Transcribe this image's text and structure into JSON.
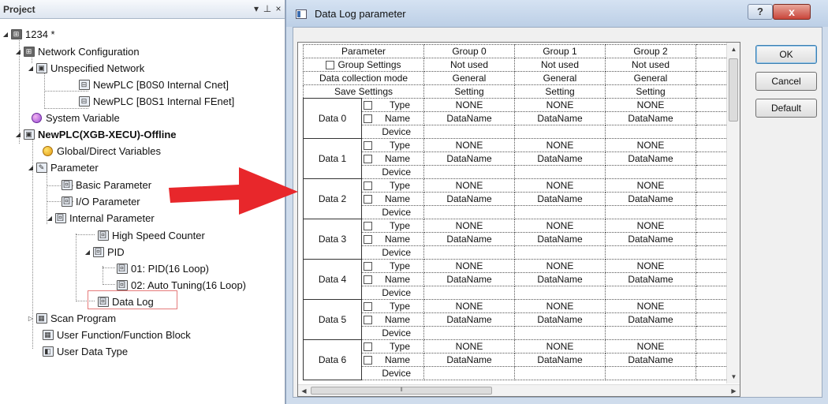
{
  "project": {
    "title": "Project",
    "pin": "▾ ꟼ",
    "close": "×",
    "tree": [
      {
        "label": "1234 *",
        "bold": false
      },
      {
        "label": "Network Configuration",
        "bold": false
      },
      {
        "label": "Unspecified Network",
        "bold": false
      },
      {
        "label": "NewPLC [B0S0 Internal Cnet]",
        "bold": false
      },
      {
        "label": "NewPLC [B0S1 Internal FEnet]",
        "bold": false
      },
      {
        "label": "System Variable",
        "bold": false
      },
      {
        "label": "NewPLC(XGB-XECU)-Offline",
        "bold": true
      },
      {
        "label": "Global/Direct Variables",
        "bold": false
      },
      {
        "label": "Parameter",
        "bold": false
      },
      {
        "label": "Basic Parameter",
        "bold": false
      },
      {
        "label": "I/O Parameter",
        "bold": false
      },
      {
        "label": "Internal Parameter",
        "bold": false
      },
      {
        "label": "High Speed Counter",
        "bold": false
      },
      {
        "label": "PID",
        "bold": false
      },
      {
        "label": "01: PID(16 Loop)",
        "bold": false
      },
      {
        "label": "02: Auto Tuning(16 Loop)",
        "bold": false
      },
      {
        "label": "Data Log",
        "bold": false
      },
      {
        "label": "Scan Program",
        "bold": false
      },
      {
        "label": "User Function/Function Block",
        "bold": false
      },
      {
        "label": "User Data Type",
        "bold": false
      }
    ]
  },
  "dialog": {
    "title": "Data Log parameter",
    "help": "?",
    "close": "x",
    "buttons": {
      "ok": "OK",
      "cancel": "Cancel",
      "default": "Default"
    },
    "table": {
      "header": {
        "parameter": "Parameter",
        "groups": [
          "Group 0",
          "Group 1",
          "Group 2"
        ]
      },
      "top_rows": [
        {
          "label": "Group Settings",
          "checkbox": true,
          "values": [
            "Not used",
            "Not used",
            "Not used"
          ]
        },
        {
          "label": "Data collection mode",
          "checkbox": false,
          "values": [
            "General",
            "General",
            "General"
          ]
        },
        {
          "label": "Save Settings",
          "checkbox": false,
          "values": [
            "Setting",
            "Setting",
            "Setting"
          ]
        }
      ],
      "data_blocks": [
        {
          "label": "Data 0",
          "type": [
            "NONE",
            "NONE",
            "NONE"
          ],
          "name": [
            "DataName",
            "DataName",
            "DataName"
          ],
          "device": [
            "",
            "",
            ""
          ]
        },
        {
          "label": "Data 1",
          "type": [
            "NONE",
            "NONE",
            "NONE"
          ],
          "name": [
            "DataName",
            "DataName",
            "DataName"
          ],
          "device": [
            "",
            "",
            ""
          ]
        },
        {
          "label": "Data 2",
          "type": [
            "NONE",
            "NONE",
            "NONE"
          ],
          "name": [
            "DataName",
            "DataName",
            "DataName"
          ],
          "device": [
            "",
            "",
            ""
          ]
        },
        {
          "label": "Data 3",
          "type": [
            "NONE",
            "NONE",
            "NONE"
          ],
          "name": [
            "DataName",
            "DataName",
            "DataName"
          ],
          "device": [
            "",
            "",
            ""
          ]
        },
        {
          "label": "Data 4",
          "type": [
            "NONE",
            "NONE",
            "NONE"
          ],
          "name": [
            "DataName",
            "DataName",
            "DataName"
          ],
          "device": [
            "",
            "",
            ""
          ]
        },
        {
          "label": "Data 5",
          "type": [
            "NONE",
            "NONE",
            "NONE"
          ],
          "name": [
            "DataName",
            "DataName",
            "DataName"
          ],
          "device": [
            "",
            "",
            ""
          ]
        },
        {
          "label": "Data 6",
          "type": [
            "NONE",
            "NONE",
            "NONE"
          ],
          "name": [
            "DataName",
            "DataName",
            "DataName"
          ],
          "device": [
            "",
            "",
            ""
          ]
        }
      ],
      "sub_labels": {
        "type": "Type",
        "name": "Name",
        "device": "Device"
      }
    }
  },
  "colors": {
    "arrow": "#e8272b",
    "selection": "#e57b7b"
  }
}
